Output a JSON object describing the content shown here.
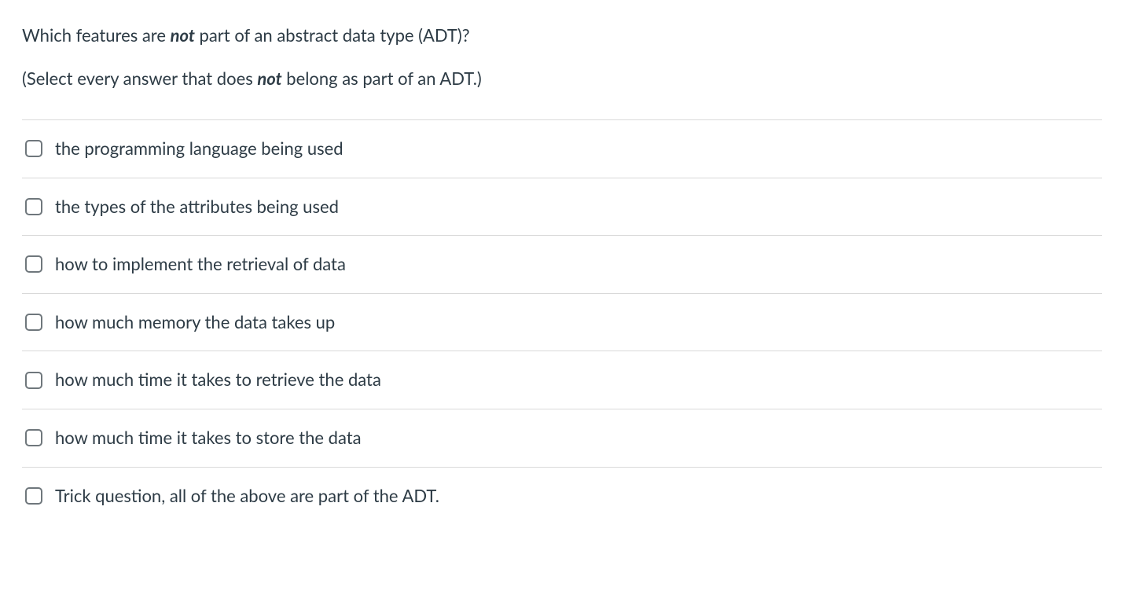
{
  "question": {
    "line1_pre": "Which features are ",
    "line1_em": "not",
    "line1_post": " part of an abstract data type (ADT)?",
    "line2_pre": "(Select every answer that does ",
    "line2_em": "not",
    "line2_post": " belong as part of an ADT.)"
  },
  "options": [
    {
      "label": "the programming language being used"
    },
    {
      "label": "the types of the attributes being used"
    },
    {
      "label": "how to implement the retrieval of data"
    },
    {
      "label": "how much memory the data takes up"
    },
    {
      "label": "how much time it takes to retrieve the data"
    },
    {
      "label": "how much time it takes to store the data"
    },
    {
      "label": "Trick question, all of the above are part of the ADT."
    }
  ]
}
